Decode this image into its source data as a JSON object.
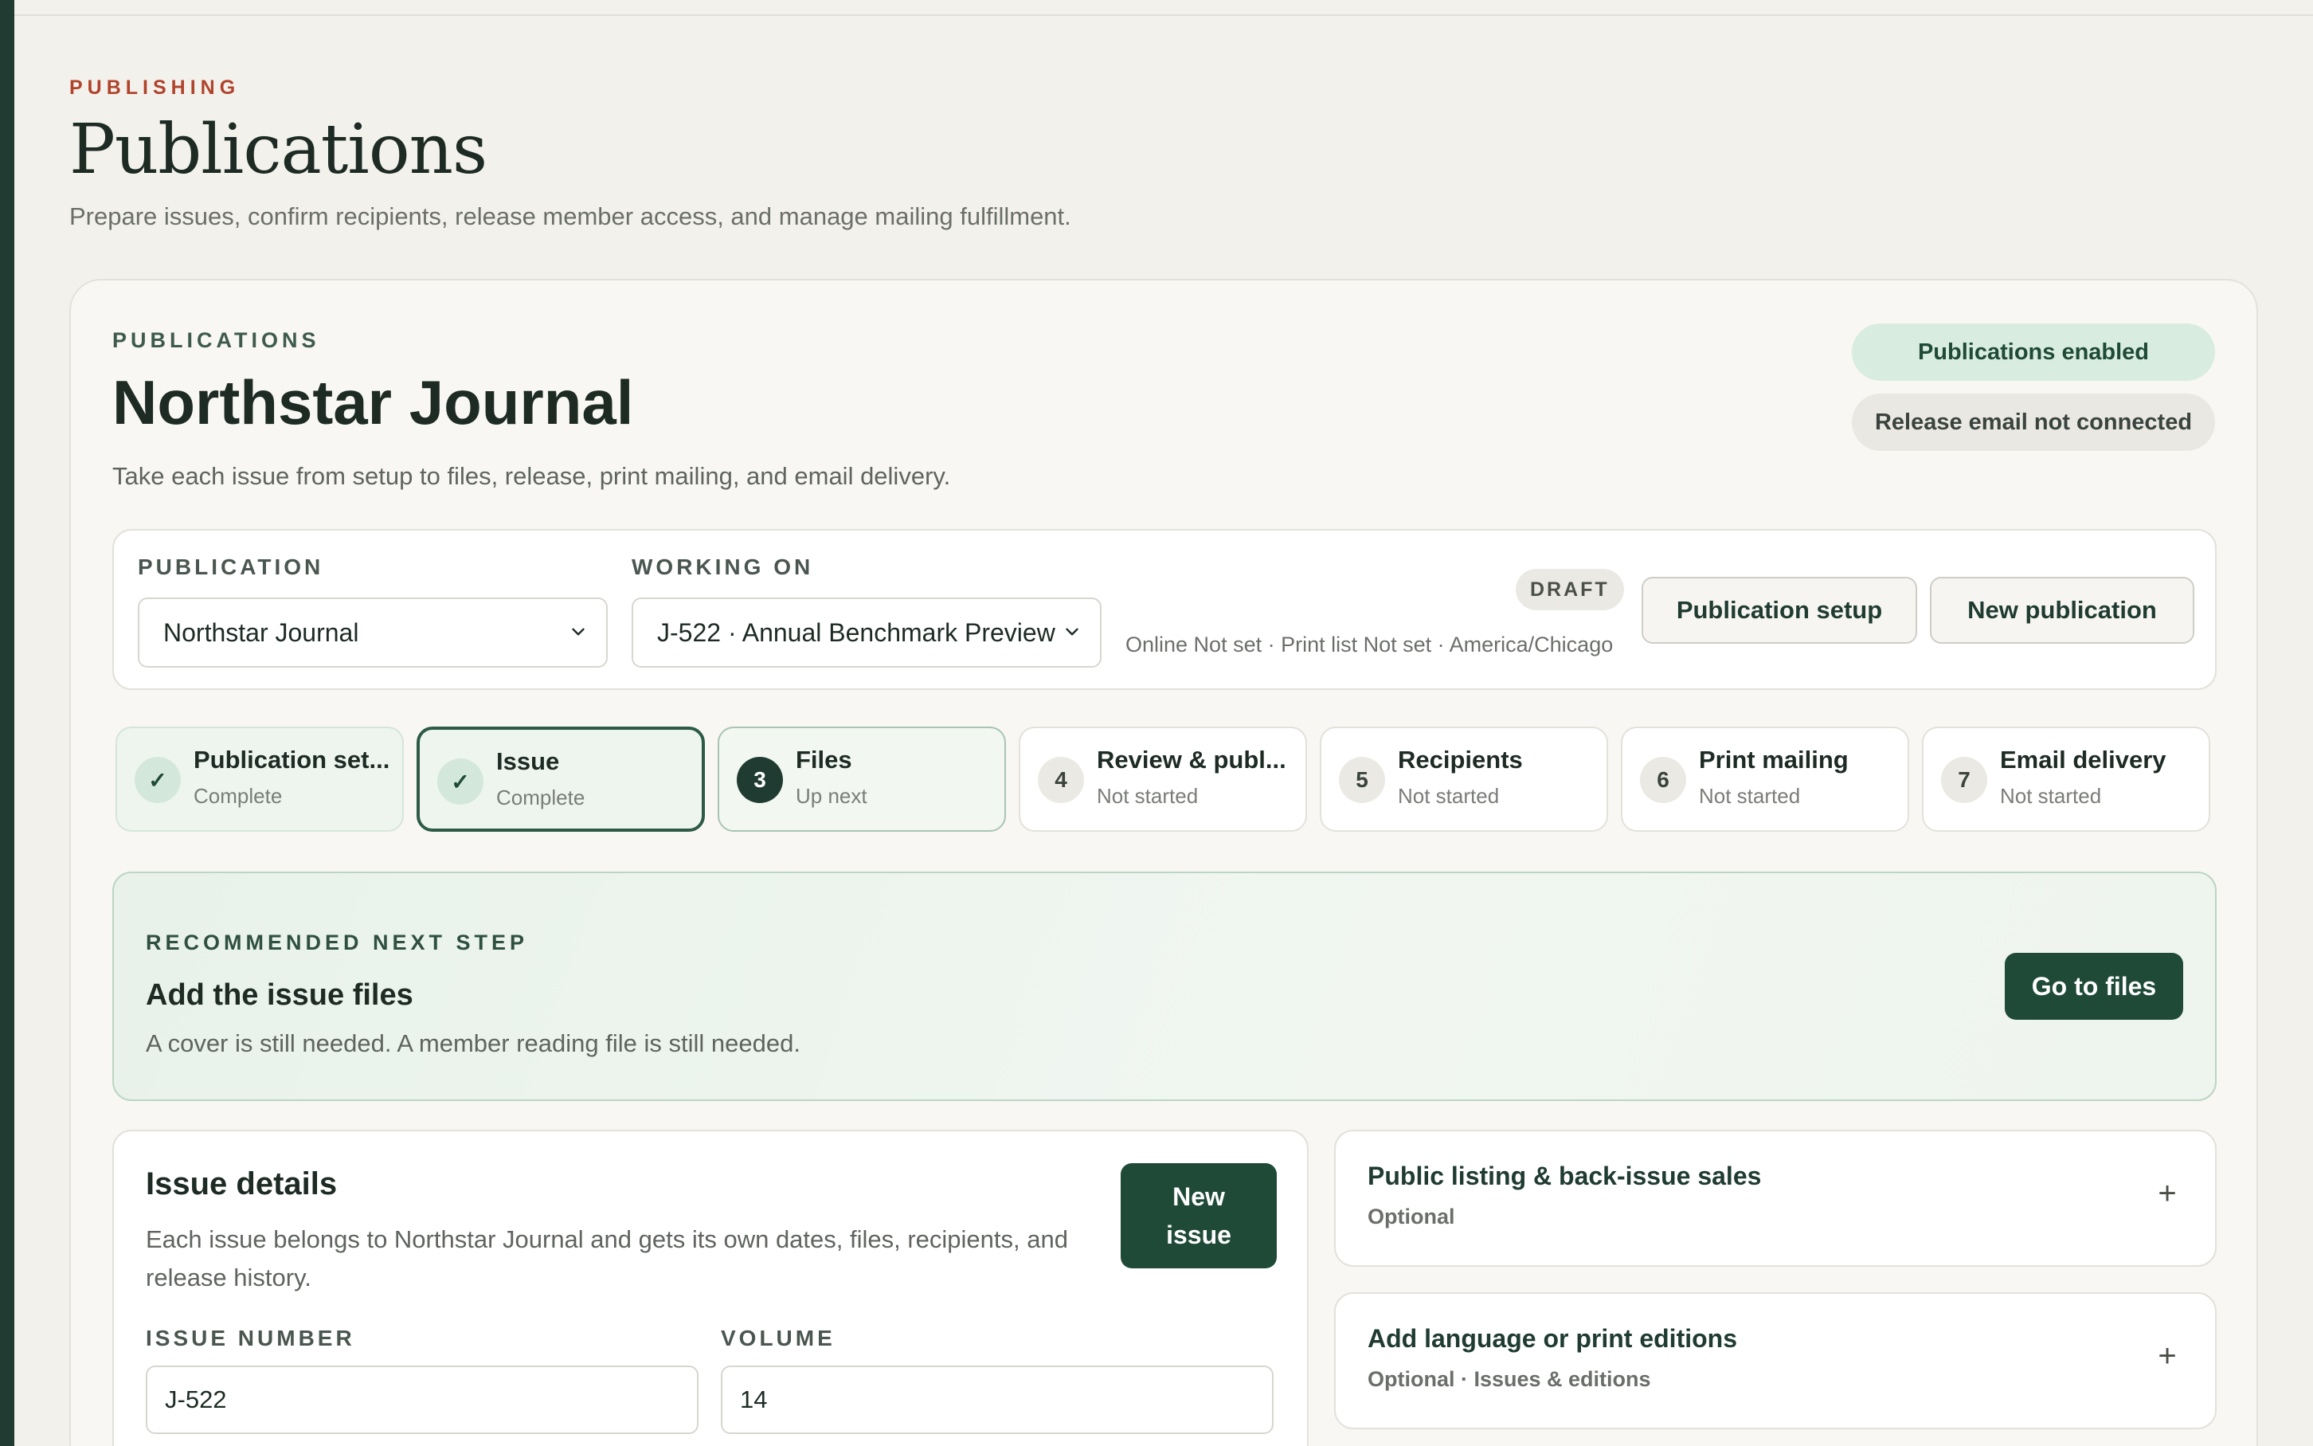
{
  "header": {
    "eyebrow": "PUBLISHING",
    "title": "Publications",
    "subtitle": "Prepare issues, confirm recipients, release member access, and manage mailing fulfillment."
  },
  "card": {
    "eyebrow": "PUBLICATIONS",
    "title": "Northstar Journal",
    "subtitle": "Take each issue from setup to files, release, print mailing, and email delivery.",
    "status_enabled": "Publications enabled",
    "status_email": "Release email not connected"
  },
  "selector": {
    "publication_label": "PUBLICATION",
    "publication_value": "Northstar Journal",
    "working_label": "WORKING ON",
    "working_value": "J-522 · Annual Benchmark Preview",
    "draft_badge": "DRAFT",
    "meta": "Online Not set · Print list Not set · America/Chicago",
    "setup_button": "Publication setup",
    "new_button": "New publication"
  },
  "steps": [
    {
      "num": "✓",
      "title": "Publication set...",
      "status": "Complete"
    },
    {
      "num": "✓",
      "title": "Issue",
      "status": "Complete"
    },
    {
      "num": "3",
      "title": "Files",
      "status": "Up next"
    },
    {
      "num": "4",
      "title": "Review & publ...",
      "status": "Not started"
    },
    {
      "num": "5",
      "title": "Recipients",
      "status": "Not started"
    },
    {
      "num": "6",
      "title": "Print mailing",
      "status": "Not started"
    },
    {
      "num": "7",
      "title": "Email delivery",
      "status": "Not started"
    }
  ],
  "recommended": {
    "eyebrow": "RECOMMENDED NEXT STEP",
    "title": "Add the issue files",
    "subtitle": "A cover is still needed. A member reading file is still needed.",
    "button": "Go to files"
  },
  "details": {
    "title": "Issue details",
    "subtitle": "Each issue belongs to Northstar Journal and gets its own dates, files, recipients, and release history.",
    "new_issue_button": "New issue",
    "issue_number_label": "ISSUE NUMBER",
    "issue_number_value": "J-522",
    "volume_label": "VOLUME",
    "volume_value": "14"
  },
  "accordions": [
    {
      "title": "Public listing & back-issue sales",
      "subtitle": "Optional"
    },
    {
      "title": "Add language or print editions",
      "subtitle": "Optional · Issues & editions"
    }
  ]
}
